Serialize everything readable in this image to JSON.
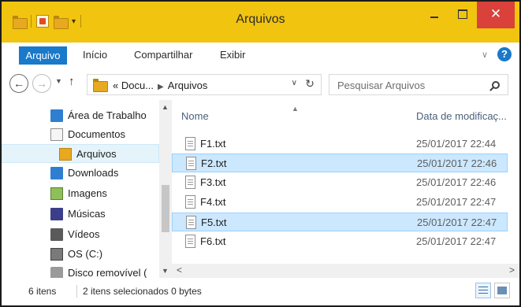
{
  "window": {
    "title": "Arquivos",
    "close_glyph": "✕"
  },
  "ribbon": {
    "tabs": [
      {
        "label": "Arquivo"
      },
      {
        "label": "Início"
      },
      {
        "label": "Compartilhar"
      },
      {
        "label": "Exibir"
      }
    ],
    "accent_color": "#1979ca",
    "help_glyph": "?"
  },
  "address": {
    "path": [
      "« Docu...",
      "Arquivos"
    ],
    "search_placeholder": "Pesquisar Arquivos"
  },
  "navigation": {
    "items": [
      {
        "label": "Área de Trabalho",
        "icon": "desktop-icon"
      },
      {
        "label": "Documentos",
        "icon": "documents-icon"
      },
      {
        "label": "Arquivos",
        "icon": "folder-icon",
        "selected": true
      },
      {
        "label": "Downloads",
        "icon": "downloads-icon"
      },
      {
        "label": "Imagens",
        "icon": "pictures-icon"
      },
      {
        "label": "Músicas",
        "icon": "music-icon"
      },
      {
        "label": "Vídeos",
        "icon": "videos-icon"
      },
      {
        "label": "OS (C:)",
        "icon": "drive-icon"
      },
      {
        "label": "Disco removível (",
        "icon": "removable-disk-icon"
      }
    ]
  },
  "file_list": {
    "columns": {
      "name": "Nome",
      "date": "Data de modificaç..."
    },
    "files": [
      {
        "name": "F1.txt",
        "date": "25/01/2017 22:44",
        "selected": false
      },
      {
        "name": "F2.txt",
        "date": "25/01/2017 22:46",
        "selected": true
      },
      {
        "name": "F3.txt",
        "date": "25/01/2017 22:46",
        "selected": false
      },
      {
        "name": "F4.txt",
        "date": "25/01/2017 22:47",
        "selected": false
      },
      {
        "name": "F5.txt",
        "date": "25/01/2017 22:47",
        "selected": true
      },
      {
        "name": "F6.txt",
        "date": "25/01/2017 22:47",
        "selected": false
      }
    ]
  },
  "status": {
    "item_count": "6 itens",
    "selection": "2 itens selecionados 0 bytes"
  },
  "colors": {
    "titlebar": "#f1c40f",
    "close_button": "#d9413a",
    "selection": "#cce8ff"
  }
}
